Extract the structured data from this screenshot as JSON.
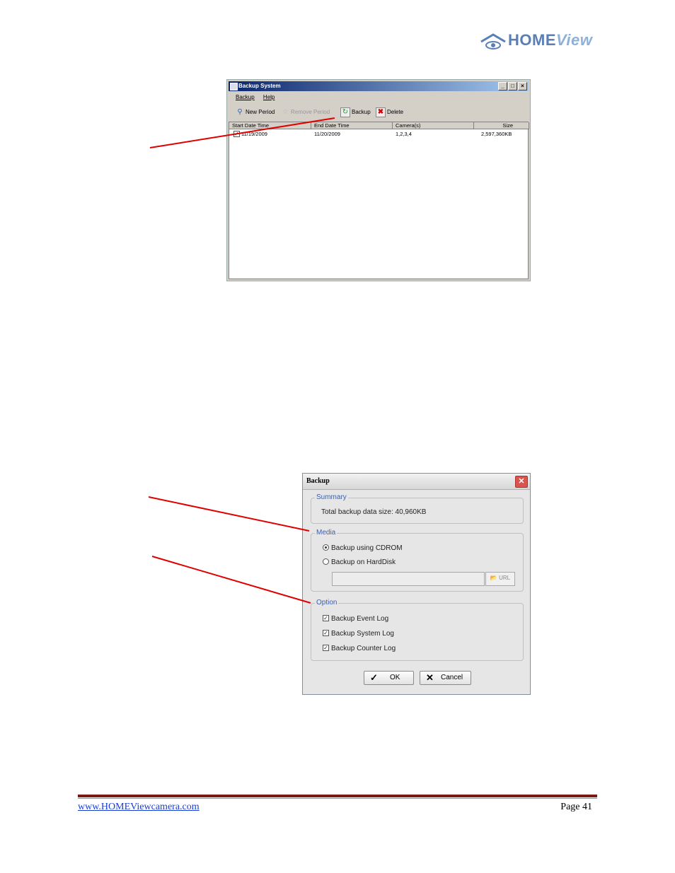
{
  "logo": {
    "brand_bold": "HOME",
    "brand_italic": "View"
  },
  "backup_system": {
    "title": "Backup System",
    "menu": [
      "Backup",
      "Help"
    ],
    "toolbar": {
      "new_period": "New Period",
      "remove_period": "Remove Period",
      "backup": "Backup",
      "delete": "Delete"
    },
    "columns": [
      "Start Date Time",
      "End Date Time",
      "Camera(s)",
      "Size"
    ],
    "rows": [
      {
        "start": "11/19/2009",
        "end": "11/20/2009",
        "cameras": "1,2,3,4",
        "size": "2,597,360KB"
      }
    ]
  },
  "backup_dialog": {
    "title": "Backup",
    "summary_label": "Summary",
    "summary_text": "Total backup data size: 40,960KB",
    "media_label": "Media",
    "media_cdrom": "Backup using CDROM",
    "media_harddisk": "Backup on HardDisk",
    "url_label": "URL",
    "option_label": "Option",
    "opt_event_log": "Backup Event Log",
    "opt_system_log": "Backup System Log",
    "opt_counter_log": "Backup Counter Log",
    "ok_label": "OK",
    "cancel_label": "Cancel"
  },
  "footer": {
    "website": "www.HOMEViewcamera.com",
    "page": "Page 41"
  },
  "colors": {
    "callout_line": "#e00000",
    "footer_rule": "#7a1a14",
    "link": "#1a3fd0",
    "group_label": "#3a5fb0"
  }
}
